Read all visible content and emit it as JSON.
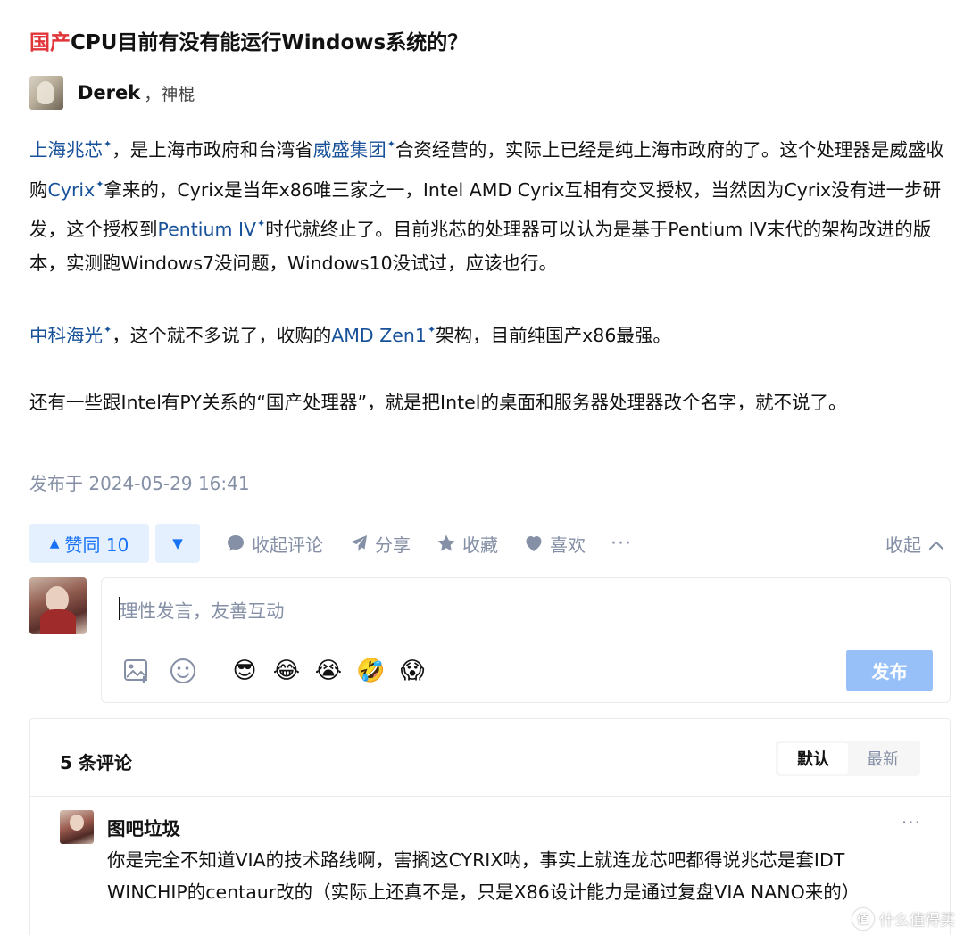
{
  "question": {
    "title_highlight": "国产",
    "title_rest": "CPU目前有没有能运行Windows系统的？"
  },
  "author": {
    "name": "Derek",
    "badge": "，神棍"
  },
  "answer": {
    "p1": {
      "link1": "上海兆芯",
      "t1": "，是上海市政府和台湾省",
      "link2": "威盛集团",
      "t2": "合资经营的，实际上已经是纯上海市政府的了。这个处理器是威盛收购",
      "link3": "Cyrix",
      "t3": "拿来的，Cyrix是当年x86唯三家之一，Intel AMD Cyrix互相有交叉授权，当然因为Cyrix没有进一步研发，这个授权到",
      "link4": "Pentium IV",
      "t4": "时代就终止了。目前兆芯的处理器可以认为是基于Pentium IV末代的架构改进的版本，实测跑Windows7没问题，Windows10没试过，应该也行。"
    },
    "p2": {
      "link1": "中科海光",
      "t1": "，这个就不多说了，收购的",
      "link2": "AMD Zen1",
      "t2": "架构，目前纯国产x86最强。"
    },
    "p3": "还有一些跟Intel有PY关系的“国产处理器”，就是把Intel的桌面和服务器处理器改个名字，就不说了。"
  },
  "publish_time": "发布于 2024-05-29 16:41",
  "actions": {
    "vote_up_label": "赞同 10",
    "vote_up_icon": "▲",
    "vote_down_icon": "▼",
    "collapse_comments": "收起评论",
    "share": "分享",
    "favorite": "收藏",
    "like": "喜欢",
    "more": "···",
    "collapse": "收起"
  },
  "editor": {
    "placeholder": "理性发言，友善互动",
    "emojis": [
      "😎",
      "😂",
      "😭",
      "🤣",
      "😱"
    ],
    "submit_label": "发布"
  },
  "comments": {
    "count_label": "5 条评论",
    "sort_default": "默认",
    "sort_latest": "最新",
    "items": [
      {
        "author": "图吧垃圾",
        "text": "你是完全不知道VIA的技术路线啊，害搁这CYRIX呐，事实上就连龙芯吧都得说兆芯是套IDT WINCHIP的centaur改的（实际上还真不是，只是X86设计能力是通过复盘VIA NANO来的）",
        "more": "···"
      }
    ]
  },
  "watermark": {
    "mark": "值",
    "text": "什么值得买"
  },
  "colors": {
    "link": "#175199",
    "accent": "#1772f6",
    "muted": "#8590a6",
    "title_highlight": "#e0363a",
    "button_disabled": "#97c0f8"
  }
}
